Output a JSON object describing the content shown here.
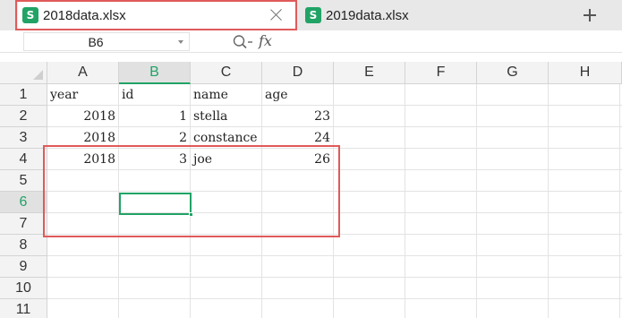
{
  "tabs": [
    {
      "label": "2018data.xlsx",
      "icon": "S"
    },
    {
      "label": "2019data.xlsx",
      "icon": "S"
    }
  ],
  "formula_bar": {
    "cell_ref": "B6",
    "fx_label": "fx",
    "value": ""
  },
  "columns": [
    "A",
    "B",
    "C",
    "D",
    "E",
    "F",
    "G",
    "H"
  ],
  "rows": [
    "1",
    "2",
    "3",
    "4",
    "5",
    "6",
    "7",
    "8",
    "9",
    "10",
    "11"
  ],
  "cells": {
    "r1": {
      "A": "year",
      "B": "id",
      "C": "name",
      "D": "age"
    },
    "r2": {
      "A": "2018",
      "B": "1",
      "C": "stella",
      "D": "23"
    },
    "r3": {
      "A": "2018",
      "B": "2",
      "C": "constance",
      "D": "24"
    },
    "r4": {
      "A": "2018",
      "B": "3",
      "C": "joe",
      "D": "26"
    }
  },
  "selected": {
    "column": "B",
    "row": "6"
  },
  "colors": {
    "accent_green": "#21a366",
    "highlight_red": "#e05a5a"
  }
}
